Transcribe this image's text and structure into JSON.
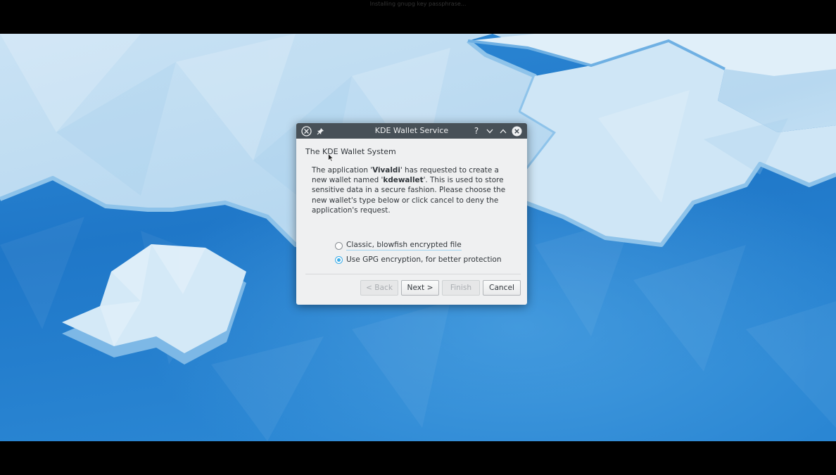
{
  "screen": {
    "top_caption": "Installing gnupg key passphrase..."
  },
  "dialog": {
    "title": "KDE Wallet Service",
    "titlebar_icons": {
      "app": "kde-app-icon",
      "pin": "pin-icon",
      "help": "help-icon",
      "minimize": "chevron-down-icon",
      "maximize": "chevron-up-icon",
      "close": "close-icon"
    },
    "heading": "The KDE Wallet System",
    "message": {
      "p1": "The application '",
      "app_name": "Vivaldi",
      "p2": "' has requested to create a new wallet named '",
      "wallet_name": "kdewallet",
      "p3": "'. This is used to store sensitive data in a secure fashion. Please choose the new wallet's type below or click cancel to deny the application's request."
    },
    "options": [
      {
        "label": "Classic, blowfish encrypted file",
        "checked": false
      },
      {
        "label": "Use GPG encryption, for better protection",
        "checked": true
      }
    ],
    "buttons": {
      "back": "< Back",
      "next": "Next >",
      "finish": "Finish",
      "cancel": "Cancel"
    }
  },
  "colors": {
    "titlebar": "#475057",
    "dialog_bg": "#eff0f1",
    "accent": "#3daee9",
    "desktop_deep": "#1d74c4",
    "desktop_light": "#cde5f5"
  }
}
